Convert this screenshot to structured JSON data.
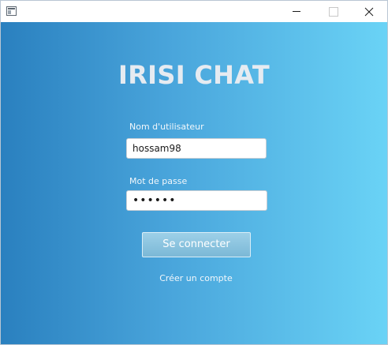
{
  "window": {
    "title": ""
  },
  "app": {
    "title": "IRISI CHAT"
  },
  "login": {
    "username_label": "Nom d'utilisateur",
    "username_value": "hossam98",
    "password_label": "Mot de passe",
    "password_value": "••••••",
    "submit_label": "Se connecter",
    "create_account_label": "Créer un compte"
  },
  "colors": {
    "gradient_start": "#2a80bf",
    "gradient_end": "#6ad3f6",
    "title_text": "#e6ebf1",
    "button_bg": "#8cc4df"
  }
}
